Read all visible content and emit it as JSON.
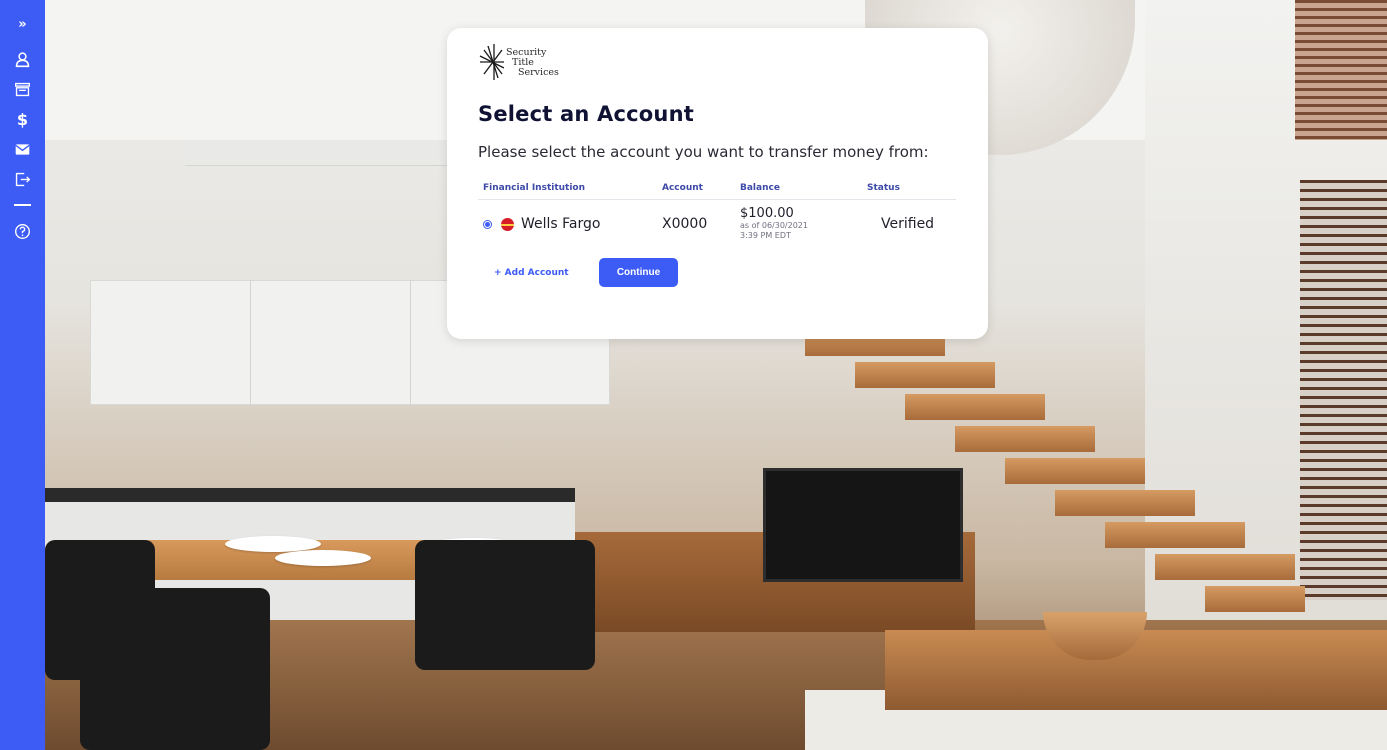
{
  "sidebar": {
    "items": [
      {
        "name": "expand",
        "icon": "double-chevron-right-icon",
        "glyph": "»"
      },
      {
        "name": "profile",
        "icon": "user-icon"
      },
      {
        "name": "bank",
        "icon": "bank-icon"
      },
      {
        "name": "payments",
        "icon": "dollar-icon",
        "glyph": "$"
      },
      {
        "name": "messages",
        "icon": "envelope-icon"
      },
      {
        "name": "logout",
        "icon": "logout-icon"
      },
      {
        "name": "help",
        "icon": "help-icon"
      }
    ],
    "background": "#3d5cf5"
  },
  "logo": {
    "line1": "Security",
    "line2": "Title",
    "line3": "Services"
  },
  "modal": {
    "title": "Select an Account",
    "subtitle": "Please select the account you want to transfer money from:",
    "columns": {
      "institution": "Financial Institution",
      "account": "Account",
      "balance": "Balance",
      "status": "Status"
    },
    "rows": [
      {
        "selected": true,
        "institution": "Wells Fargo",
        "institution_icon": "wells-fargo-logo-icon",
        "account": "X0000",
        "balance": "$100.00",
        "balance_date": "as of 06/30/2021",
        "balance_time": "3:39 PM EDT",
        "status": "Verified"
      }
    ],
    "add_account_label": "+ Add Account",
    "continue_label": "Continue"
  },
  "colors": {
    "accent": "#3d5cf5",
    "heading": "#0f1233",
    "column_header": "#3d4aa8"
  }
}
